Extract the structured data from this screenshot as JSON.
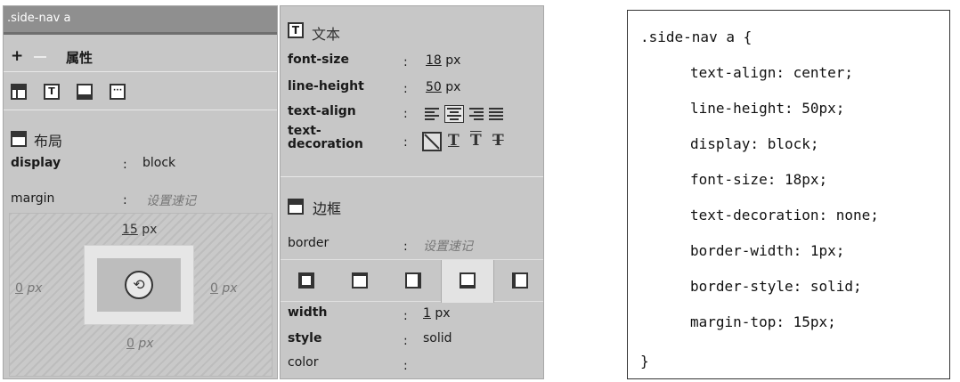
{
  "left_panel": {
    "selector": ".side-nav a",
    "toolbar": {
      "plus": "+",
      "title": "属性"
    },
    "tab_icons": [
      "layout-icon",
      "text-icon",
      "border-icon",
      "more-icon"
    ],
    "text_tab_glyph": "T",
    "more_tab_glyph": "···",
    "layout": {
      "title": "布局",
      "display_label": "display",
      "display_value": "block",
      "margin_label": "margin",
      "margin_value": "设置速记",
      "margin_top": "15",
      "margin_right": "0",
      "margin_bottom": "0",
      "margin_left": "0",
      "unit_px": "px",
      "link_glyph": "⟲"
    },
    "colon": ":"
  },
  "middle_panel": {
    "text_section": {
      "glyph": "T",
      "title": "文本",
      "font_size_label": "font-size",
      "font_size_value": "18",
      "line_height_label": "line-height",
      "line_height_value": "50",
      "unit": "px",
      "text_align_label": "text-align",
      "text_align_icons": [
        "align-left-icon",
        "align-center-icon",
        "align-right-icon",
        "align-justify-icon"
      ],
      "text_align_selected": "center",
      "text_decoration_label_1": "text-",
      "text_decoration_label_2": "decoration",
      "decoration_glyphs": [
        "T",
        "T",
        "T"
      ],
      "decoration_selected": "none"
    },
    "border_section": {
      "title": "边框",
      "border_label": "border",
      "border_value": "设置速记",
      "side_tabs": [
        "all-sides-icon",
        "top-side-icon",
        "right-side-icon",
        "bottom-side-icon",
        "left-side-icon"
      ],
      "active_tab": "bottom-side-icon",
      "width_label": "width",
      "width_value": "1",
      "width_unit": "px",
      "style_label": "style",
      "style_value": "solid",
      "color_label": "color",
      "color_value": ""
    },
    "colon": ":"
  },
  "code_panel": {
    "lines": [
      ".side-nav a {",
      "text-align: center;",
      "line-height: 50px;",
      "display: block;",
      "font-size: 18px;",
      "text-decoration: none;",
      "border-width: 1px;",
      "border-style: solid;",
      "margin-top: 15px;",
      "}"
    ]
  }
}
